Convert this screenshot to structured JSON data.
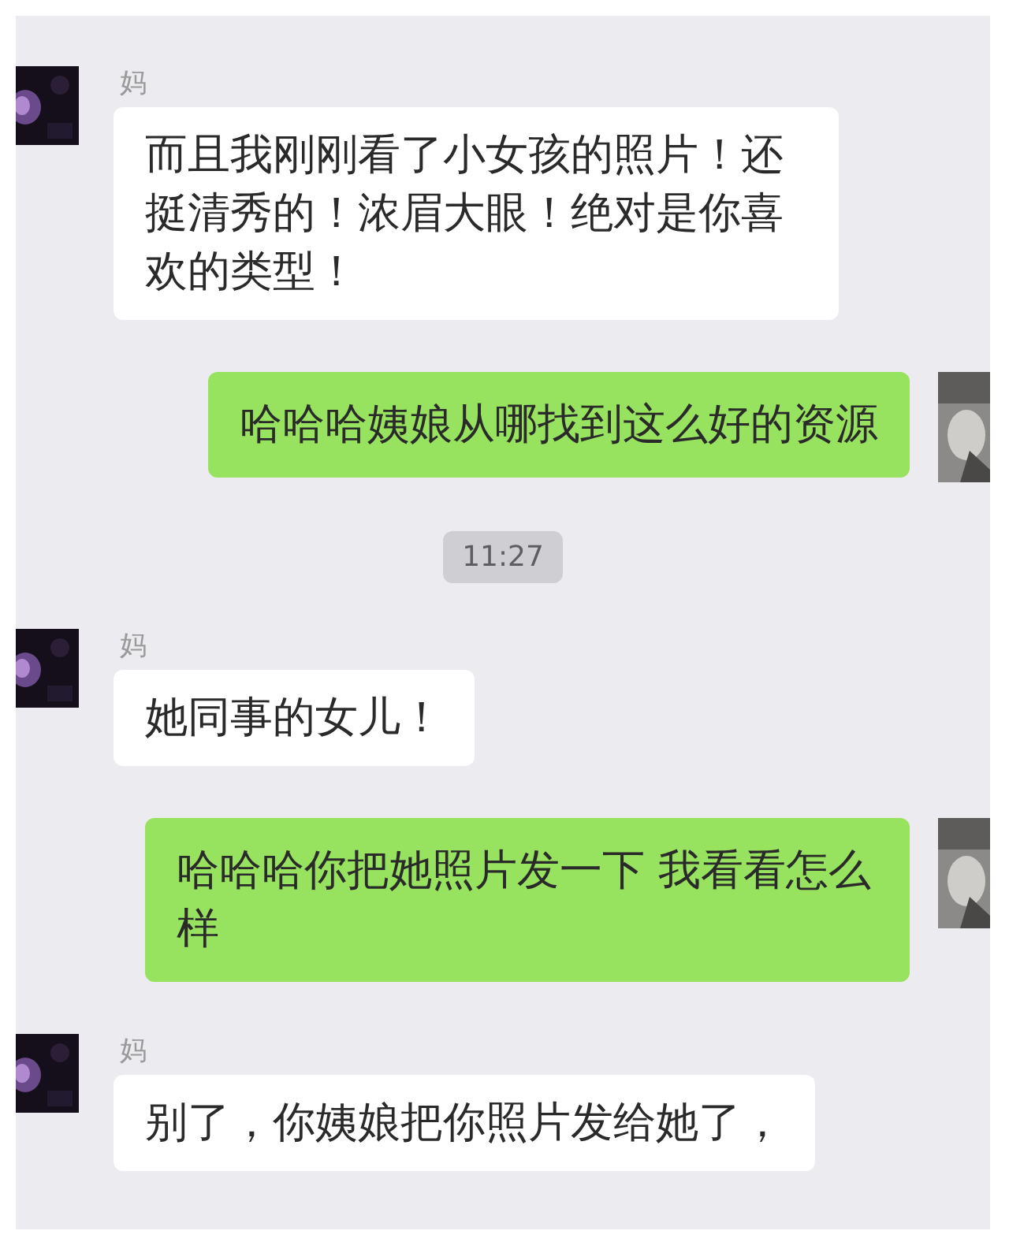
{
  "messages": [
    {
      "kind": "received",
      "sender": "妈",
      "text": "而且我刚刚看了小女孩的照片！还挺清秀的！浓眉大眼！绝对是你喜欢的类型！"
    },
    {
      "kind": "sent",
      "text": "哈哈哈姨娘从哪找到这么好的资源"
    },
    {
      "kind": "time",
      "text": "11:27"
    },
    {
      "kind": "received",
      "sender": "妈",
      "text": "她同事的女儿！"
    },
    {
      "kind": "sent",
      "text": "哈哈哈你把她照片发一下 我看看怎么样"
    },
    {
      "kind": "received",
      "sender": "妈",
      "text": "别了，你姨娘把你照片发给她了，"
    }
  ]
}
